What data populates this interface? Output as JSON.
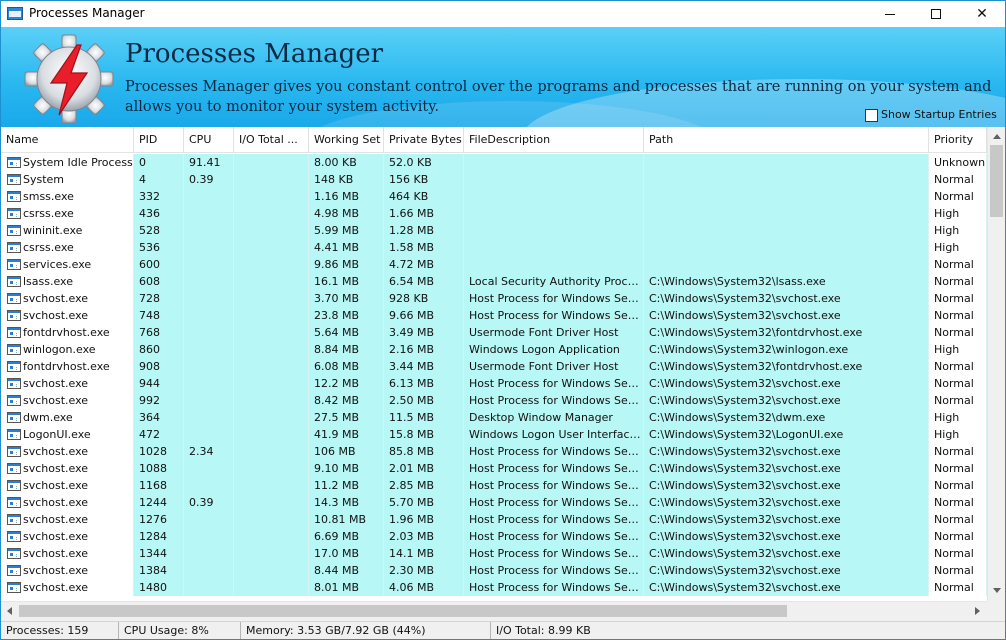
{
  "window": {
    "title": "Processes Manager",
    "close_glyph": "✕"
  },
  "banner": {
    "title": "Processes Manager",
    "description": "Processes Manager gives you constant control over the programs and processes that are running on your system and allows you to monitor your system activity.",
    "startup_label": "Show Startup Entries"
  },
  "columns": [
    "Name",
    "PID",
    "CPU",
    "I/O Total ...",
    "Working Set",
    "Private Bytes",
    "FileDescription",
    "Path",
    "Priority"
  ],
  "processes": [
    [
      "System Idle Process",
      "0",
      "91.41",
      "",
      "8.00 KB",
      "52.0 KB",
      "",
      "",
      "Unknown"
    ],
    [
      "System",
      "4",
      "0.39",
      "",
      "148 KB",
      "156 KB",
      "",
      "",
      "Normal"
    ],
    [
      "smss.exe",
      "332",
      "",
      "",
      "1.16 MB",
      "464 KB",
      "",
      "",
      "Normal"
    ],
    [
      "csrss.exe",
      "436",
      "",
      "",
      "4.98 MB",
      "1.66 MB",
      "",
      "",
      "High"
    ],
    [
      "wininit.exe",
      "528",
      "",
      "",
      "5.99 MB",
      "1.28 MB",
      "",
      "",
      "High"
    ],
    [
      "csrss.exe",
      "536",
      "",
      "",
      "4.41 MB",
      "1.58 MB",
      "",
      "",
      "High"
    ],
    [
      "services.exe",
      "600",
      "",
      "",
      "9.86 MB",
      "4.72 MB",
      "",
      "",
      "Normal"
    ],
    [
      "lsass.exe",
      "608",
      "",
      "",
      "16.1 MB",
      "6.54 MB",
      "Local Security Authority Process",
      "C:\\Windows\\System32\\lsass.exe",
      "Normal"
    ],
    [
      "svchost.exe",
      "728",
      "",
      "",
      "3.70 MB",
      "928 KB",
      "Host Process for Windows Servi...",
      "C:\\Windows\\System32\\svchost.exe",
      "Normal"
    ],
    [
      "svchost.exe",
      "748",
      "",
      "",
      "23.8 MB",
      "9.66 MB",
      "Host Process for Windows Servi...",
      "C:\\Windows\\System32\\svchost.exe",
      "Normal"
    ],
    [
      "fontdrvhost.exe",
      "768",
      "",
      "",
      "5.64 MB",
      "3.49 MB",
      "Usermode Font Driver Host",
      "C:\\Windows\\System32\\fontdrvhost.exe",
      "Normal"
    ],
    [
      "winlogon.exe",
      "860",
      "",
      "",
      "8.84 MB",
      "2.16 MB",
      "Windows Logon Application",
      "C:\\Windows\\System32\\winlogon.exe",
      "High"
    ],
    [
      "fontdrvhost.exe",
      "908",
      "",
      "",
      "6.08 MB",
      "3.44 MB",
      "Usermode Font Driver Host",
      "C:\\Windows\\System32\\fontdrvhost.exe",
      "Normal"
    ],
    [
      "svchost.exe",
      "944",
      "",
      "",
      "12.2 MB",
      "6.13 MB",
      "Host Process for Windows Servi...",
      "C:\\Windows\\System32\\svchost.exe",
      "Normal"
    ],
    [
      "svchost.exe",
      "992",
      "",
      "",
      "8.42 MB",
      "2.50 MB",
      "Host Process for Windows Servi...",
      "C:\\Windows\\System32\\svchost.exe",
      "Normal"
    ],
    [
      "dwm.exe",
      "364",
      "",
      "",
      "27.5 MB",
      "11.5 MB",
      "Desktop Window Manager",
      "C:\\Windows\\System32\\dwm.exe",
      "High"
    ],
    [
      "LogonUI.exe",
      "472",
      "",
      "",
      "41.9 MB",
      "15.8 MB",
      "Windows Logon User Interface ...",
      "C:\\Windows\\System32\\LogonUI.exe",
      "High"
    ],
    [
      "svchost.exe",
      "1028",
      "2.34",
      "",
      "106 MB",
      "85.8 MB",
      "Host Process for Windows Servi...",
      "C:\\Windows\\System32\\svchost.exe",
      "Normal"
    ],
    [
      "svchost.exe",
      "1088",
      "",
      "",
      "9.10 MB",
      "2.01 MB",
      "Host Process for Windows Servi...",
      "C:\\Windows\\System32\\svchost.exe",
      "Normal"
    ],
    [
      "svchost.exe",
      "1168",
      "",
      "",
      "11.2 MB",
      "2.85 MB",
      "Host Process for Windows Servi...",
      "C:\\Windows\\System32\\svchost.exe",
      "Normal"
    ],
    [
      "svchost.exe",
      "1244",
      "0.39",
      "",
      "14.3 MB",
      "5.70 MB",
      "Host Process for Windows Servi...",
      "C:\\Windows\\System32\\svchost.exe",
      "Normal"
    ],
    [
      "svchost.exe",
      "1276",
      "",
      "",
      "10.81 MB",
      "1.96 MB",
      "Host Process for Windows Servi...",
      "C:\\Windows\\System32\\svchost.exe",
      "Normal"
    ],
    [
      "svchost.exe",
      "1284",
      "",
      "",
      "6.69 MB",
      "2.03 MB",
      "Host Process for Windows Servi...",
      "C:\\Windows\\System32\\svchost.exe",
      "Normal"
    ],
    [
      "svchost.exe",
      "1344",
      "",
      "",
      "17.0 MB",
      "14.1 MB",
      "Host Process for Windows Servi...",
      "C:\\Windows\\System32\\svchost.exe",
      "Normal"
    ],
    [
      "svchost.exe",
      "1384",
      "",
      "",
      "8.44 MB",
      "2.30 MB",
      "Host Process for Windows Servi...",
      "C:\\Windows\\System32\\svchost.exe",
      "Normal"
    ],
    [
      "svchost.exe",
      "1480",
      "",
      "",
      "8.01 MB",
      "4.06 MB",
      "Host Process for Windows Servi...",
      "C:\\Windows\\System32\\svchost.exe",
      "Normal"
    ]
  ],
  "status": {
    "processes": "Processes: 159",
    "cpu": "CPU Usage: 8%",
    "memory": "Memory: 3.53 GB/7.92 GB (44%)",
    "io": "I/O Total: 8.99 KB"
  },
  "colors": {
    "row_highlight": "#b7f7f6",
    "banner": "#2ab8f0",
    "logo_bolt": "#e81e2a"
  }
}
